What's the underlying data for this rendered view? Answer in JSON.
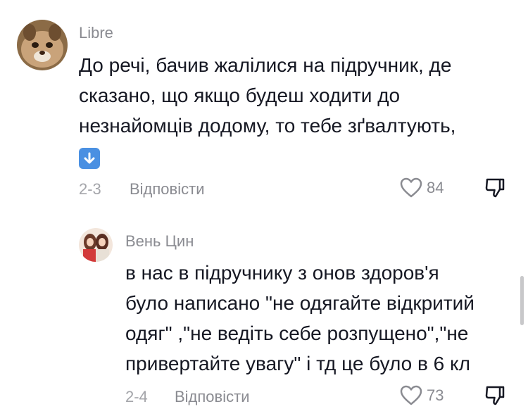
{
  "comments": [
    {
      "username": "Libre",
      "text_lines": [
        "До речі, бачив жалілися на підручник, де",
        "сказано, що якщо будеш ходити до",
        "незнайомців додому, то тебе зґвалтують,"
      ],
      "emoji": "down-arrow-button-emoji",
      "date": "2-3",
      "reply_label": "Відповісти",
      "likes": "84"
    },
    {
      "username": "Вень Цин",
      "text_lines": [
        "в нас в підручнику з онов здоров'я",
        "було написано \"не одягайте відкритий",
        "одяг\" ,\"не ведіть себе розпущено\",\"не",
        "привертайте увагу\" і тд це було в 6 кл"
      ],
      "date": "2-4",
      "reply_label": "Відповісти",
      "likes": "73"
    }
  ]
}
